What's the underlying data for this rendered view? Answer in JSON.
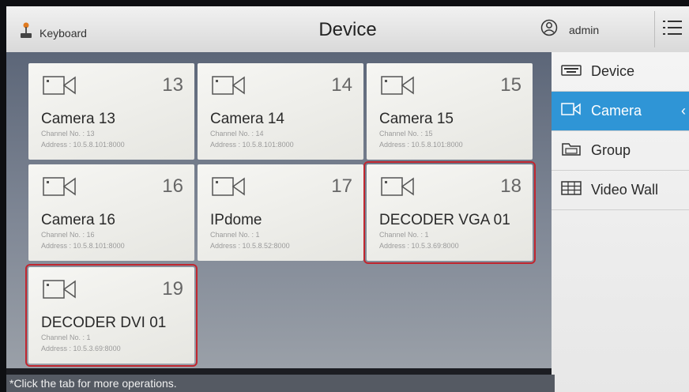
{
  "header": {
    "left_label": "Keyboard",
    "title": "Device",
    "user": "admin"
  },
  "cards": [
    {
      "number": "13",
      "name": "Camera 13",
      "channel": "Channel No. : 13",
      "address": "Address : 10.5.8.101:8000",
      "selected": false
    },
    {
      "number": "14",
      "name": "Camera 14",
      "channel": "Channel No. : 14",
      "address": "Address : 10.5.8.101:8000",
      "selected": false
    },
    {
      "number": "15",
      "name": "Camera 15",
      "channel": "Channel No. : 15",
      "address": "Address : 10.5.8.101:8000",
      "selected": false
    },
    {
      "number": "16",
      "name": "Camera 16",
      "channel": "Channel No. : 16",
      "address": "Address : 10.5.8.101:8000",
      "selected": false
    },
    {
      "number": "17",
      "name": "IPdome",
      "channel": "Channel No. : 1",
      "address": "Address : 10.5.8.52:8000",
      "selected": false
    },
    {
      "number": "18",
      "name": "DECODER VGA 01",
      "channel": "Channel No. : 1",
      "address": "Address : 10.5.3.69:8000",
      "selected": true
    },
    {
      "number": "19",
      "name": "DECODER DVI 01",
      "channel": "Channel No. : 1",
      "address": "Address : 10.5.3.69:8000",
      "selected": true
    }
  ],
  "sidebar": {
    "items": [
      {
        "label": "Device",
        "icon": "keyboard-icon",
        "active": false
      },
      {
        "label": "Camera",
        "icon": "camera-icon",
        "active": true
      },
      {
        "label": "Group",
        "icon": "group-icon",
        "active": false
      },
      {
        "label": "Video Wall",
        "icon": "video-wall-icon",
        "active": false
      }
    ]
  },
  "footer": {
    "hint": "*Click the tab for more operations."
  },
  "colors": {
    "accent": "#2f95d6",
    "selection": "#c0262f"
  }
}
